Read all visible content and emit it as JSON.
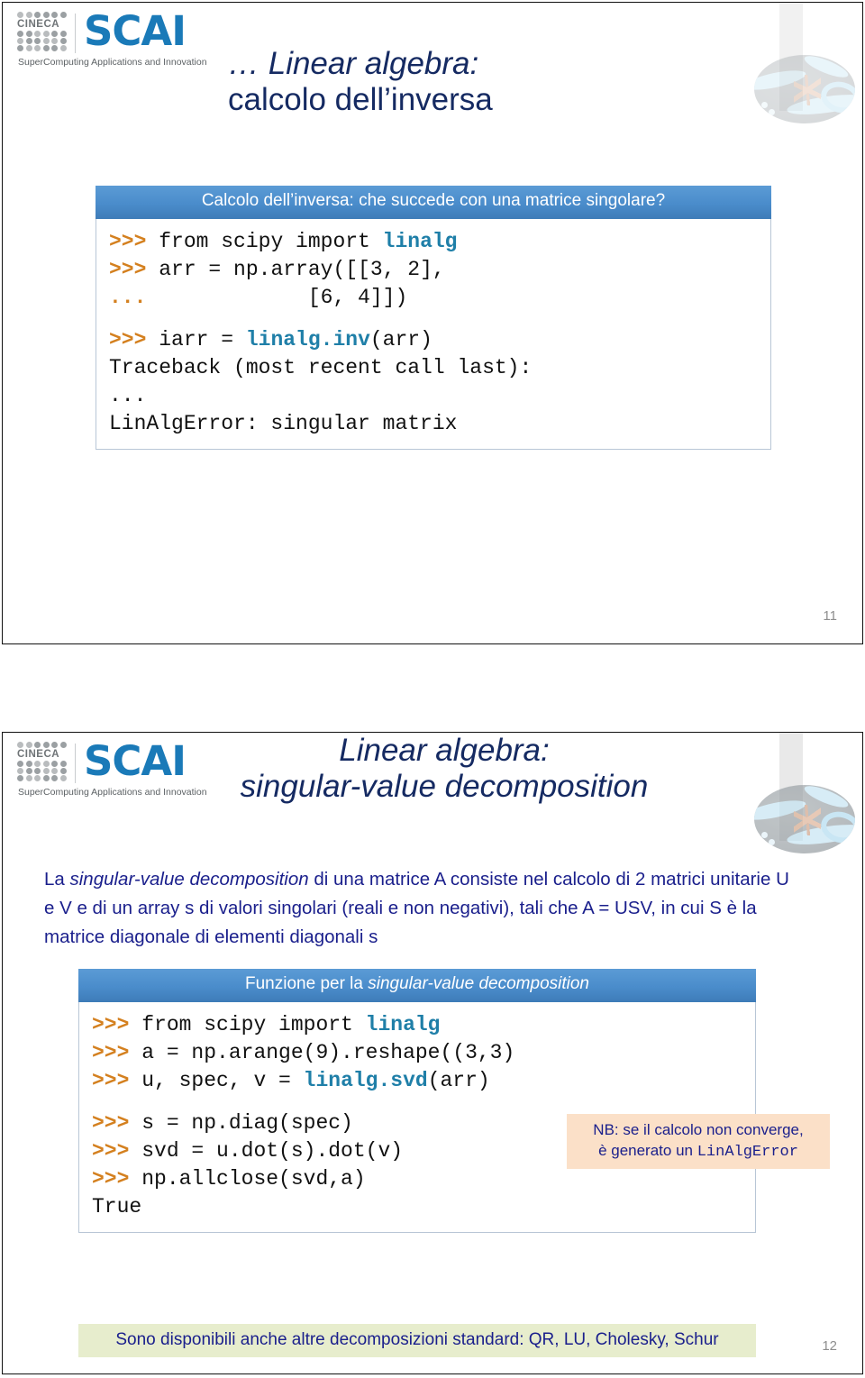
{
  "logo": {
    "brand": "SCAI",
    "org": "CINECA",
    "tagline": "SuperComputing Applications and Innovation",
    "brand_color": "#1a7ab8"
  },
  "colors": {
    "title": "#152a62",
    "body_text": "#1a1f8c",
    "card_header_bg": "#4a8ccb",
    "prompt": "#d4801f",
    "module": "#1f7fa8",
    "callout_bg": "#fbe0c8",
    "footer_bg": "#e7edcd",
    "page_number": "#8e8e8e"
  },
  "slide1": {
    "title_line1": "… Linear algebra:",
    "title_line2": "calcolo dell’inversa",
    "card": {
      "header": "Calcolo dell’inversa: che succede con una matrice singolare?",
      "lines": [
        {
          "prompt": ">>> ",
          "pre": "from scipy import ",
          "mod": "linalg",
          "post": ""
        },
        {
          "prompt": ">>> ",
          "pre": "arr = np.array([[3, 2],",
          "mod": "",
          "post": ""
        },
        {
          "prompt": "... ",
          "pre": "            [6, 4]])",
          "mod": "",
          "post": ""
        },
        {
          "prompt": "",
          "pre": "",
          "mod": "",
          "post": "",
          "blank": true
        },
        {
          "prompt": ">>> ",
          "pre": "iarr = ",
          "mod": "linalg.inv",
          "post": "(arr)"
        },
        {
          "prompt": "",
          "pre": "Traceback (most recent call last):",
          "mod": "",
          "post": ""
        },
        {
          "prompt": "",
          "pre": "...",
          "mod": "",
          "post": ""
        },
        {
          "prompt": "",
          "pre": "LinAlgError: singular matrix",
          "mod": "",
          "post": ""
        }
      ]
    },
    "page_number": "11"
  },
  "slide2": {
    "title_line1": "Linear algebra:",
    "title_line2": "singular-value decomposition",
    "paragraph_parts": {
      "p1": "La ",
      "em1": "singular-value decomposition",
      "p2": " di una matrice A consiste nel calcolo di 2 matrici unitarie U e V e di un array s di valori singolari (reali e non negativi), tali che A = USV, in cui S è la matrice diagonale di elementi diagonali s"
    },
    "card": {
      "header_pre": "Funzione per la ",
      "header_em": "singular-value decomposition",
      "lines": [
        {
          "prompt": ">>> ",
          "pre": "from scipy import ",
          "mod": "linalg",
          "post": ""
        },
        {
          "prompt": ">>> ",
          "pre": "a = np.arange(9).reshape((3,3)",
          "mod": "",
          "post": ""
        },
        {
          "prompt": ">>> ",
          "pre": "u, spec, v = ",
          "mod": "linalg.svd",
          "post": "(arr)"
        },
        {
          "prompt": "",
          "pre": "",
          "mod": "",
          "post": "",
          "blank": true
        },
        {
          "prompt": ">>> ",
          "pre": "s = np.diag(spec)",
          "mod": "",
          "post": ""
        },
        {
          "prompt": ">>> ",
          "pre": "svd = u.dot(s).dot(v)",
          "mod": "",
          "post": ""
        },
        {
          "prompt": ">>> ",
          "pre": "np.allclose(svd,a)",
          "mod": "",
          "post": ""
        },
        {
          "prompt": "",
          "pre": "True",
          "mod": "",
          "post": ""
        }
      ]
    },
    "callout": {
      "line1": "NB: se il calcolo non converge,",
      "line2_pre": "è generato un ",
      "line2_code": "LinAlgError"
    },
    "footer": "Sono disponibili anche altre decomposizioni standard: QR, LU, Cholesky, Schur",
    "page_number": "12"
  }
}
